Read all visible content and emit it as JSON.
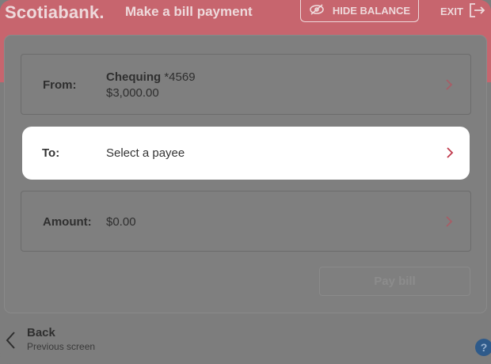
{
  "header": {
    "brand": "Scotiabank",
    "brand_dot": ".",
    "title": "Make a bill payment",
    "hide_balance_label": "HIDE BALANCE",
    "exit_label": "EXIT"
  },
  "form": {
    "from": {
      "label": "From:",
      "account_name": "Chequing",
      "account_number": "*4569",
      "balance": "$3,000.00"
    },
    "to": {
      "label": "To:",
      "placeholder": "Select a payee"
    },
    "amount": {
      "label": "Amount:",
      "value": "$0.00"
    },
    "pay_button_label": "Pay bill"
  },
  "footer": {
    "back_label": "Back",
    "back_sub": "Previous screen",
    "help_label": "?"
  },
  "colors": {
    "brand_red": "#c7656e",
    "overlay_gray": "#7f7f7f",
    "chevron_red": "#c0394b",
    "chevron_muted": "#a85d66"
  },
  "icons": {
    "hide": "eye-slash-icon",
    "exit": "exit-icon",
    "chevron": "chevron-right-icon",
    "back": "chevron-left-icon",
    "help": "help-icon"
  }
}
